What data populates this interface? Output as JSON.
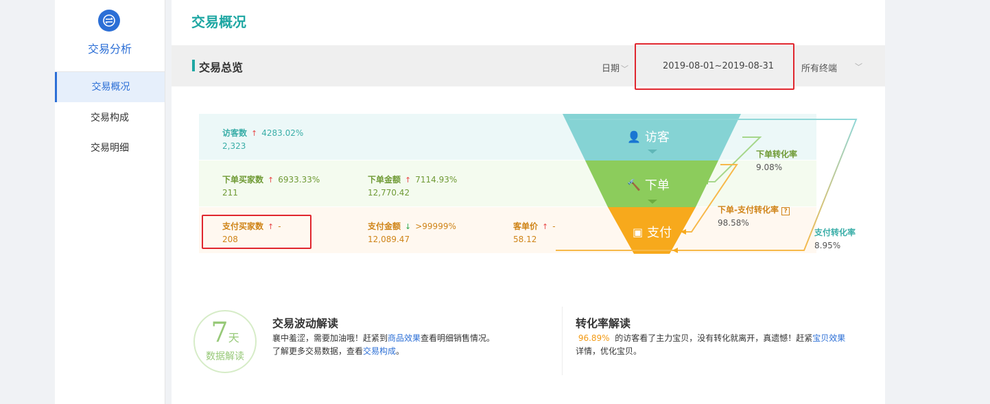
{
  "sidebar": {
    "title": "交易分析",
    "items": [
      {
        "label": "交易概况"
      },
      {
        "label": "交易构成"
      },
      {
        "label": "交易明细"
      }
    ]
  },
  "main": {
    "page_title": "交易概况",
    "section_title": "交易总览",
    "date_label": "日期",
    "date_range": "2019-08-01~2019-08-31",
    "terminal": "所有终端"
  },
  "funnel": {
    "stages": [
      {
        "label": "访客",
        "color": "#7fd1d3"
      },
      {
        "label": "下单",
        "color": "#8ccc5c"
      },
      {
        "label": "支付",
        "color": "#f7a91c"
      }
    ],
    "visitors": {
      "label": "访客数",
      "change": "4283.02%",
      "value": "2,323"
    },
    "order_buyers": {
      "label": "下单买家数",
      "change": "6933.33%",
      "value": "211"
    },
    "order_amount": {
      "label": "下单金额",
      "change": "7114.93%",
      "value": "12,770.42"
    },
    "pay_buyers": {
      "label": "支付买家数",
      "change": "-",
      "value": "208"
    },
    "pay_amount": {
      "label": "支付金额",
      "change": ">99999%",
      "value": "12,089.47"
    },
    "avg_price": {
      "label": "客单价",
      "change": "-",
      "value": "58.12"
    },
    "order_rate": {
      "label": "下单转化率",
      "value": "9.08%"
    },
    "order_pay_rate": {
      "label": "下单-支付转化率",
      "value": "98.58%"
    },
    "pay_rate": {
      "label": "支付转化率",
      "value": "8.95%"
    }
  },
  "bottom": {
    "badge_num": "7",
    "badge_unit": "天",
    "badge_sub": "数据解读",
    "fluct_title": "交易波动解读",
    "fluct_p1": "襄中羞涩，需要加油哦！赶紧到",
    "fluct_link1": "商品效果",
    "fluct_p2": "查看明细销售情况。",
    "fluct_p3": "了解更多交易数据，查看",
    "fluct_link2": "交易构成",
    "fluct_p4": "。",
    "conv_title": "转化率解读",
    "conv_pct": "96.89%",
    "conv_p1": "的访客看了主力宝贝，没有转化就离开，真遗憾！赶紧",
    "conv_link": "宝贝效果",
    "conv_p2": "详情，优化宝贝。"
  }
}
